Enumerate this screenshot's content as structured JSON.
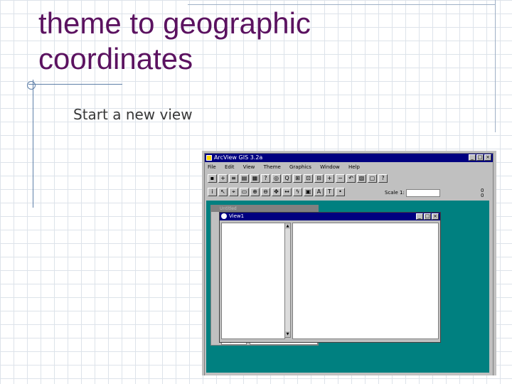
{
  "slide": {
    "title_line1": "theme to geographic",
    "title_line2": "coordinates",
    "bullet": "Start a new view"
  },
  "app": {
    "title": "ArcView GIS 3.2a",
    "menu": [
      "File",
      "Edit",
      "View",
      "Theme",
      "Graphics",
      "Window",
      "Help"
    ],
    "scale_label": "Scale 1:",
    "scale_value": "",
    "coord_x": "0",
    "coord_y": "0",
    "project_window_title": "Untitled",
    "project_field": "Scripts",
    "view_window_title": "View1"
  },
  "colors": {
    "title": "#5b1260",
    "bullet": "#383838",
    "title_bar": "#000080",
    "desktop": "#008080"
  }
}
